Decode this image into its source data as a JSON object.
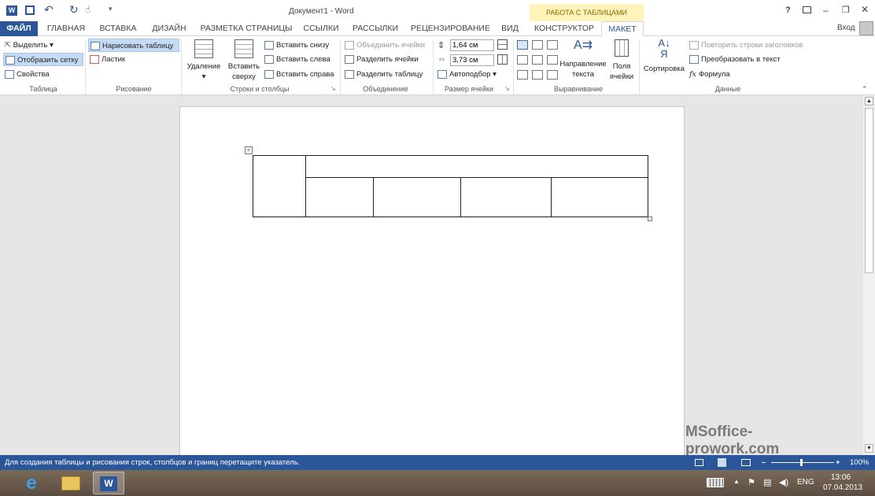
{
  "window": {
    "title": "Документ1 - Word",
    "context_group": "РАБОТА С ТАБЛИЦАМИ",
    "user": "Вход"
  },
  "tabs": [
    "ФАЙЛ",
    "ГЛАВНАЯ",
    "ВСТАВКА",
    "ДИЗАЙН",
    "РАЗМЕТКА СТРАНИЦЫ",
    "ССЫЛКИ",
    "РАССЫЛКИ",
    "РЕЦЕНЗИРОВАНИЕ",
    "ВИД",
    "КОНСТРУКТОР",
    "МАКЕТ"
  ],
  "ribbon": {
    "table_group": {
      "select": "Выделить",
      "gridlines": "Отобразить сетку",
      "properties": "Свойства",
      "label": "Таблица"
    },
    "draw_group": {
      "draw": "Нарисовать таблицу",
      "eraser": "Ластик",
      "label": "Рисование"
    },
    "rows_cols": {
      "delete": "Удаление",
      "insert_above": "Вставить сверху",
      "insert_below": "Вставить снизу",
      "insert_left": "Вставить слева",
      "insert_right": "Вставить справа",
      "label": "Строки и столбцы"
    },
    "merge": {
      "merge": "Объединить ячейки",
      "split_cells": "Разделить ячейки",
      "split_table": "Разделить таблицу",
      "label": "Объединение"
    },
    "cell_size": {
      "height": "1,64 см",
      "width": "3,73 см",
      "autofit": "Автоподбор",
      "label": "Размер ячейки"
    },
    "alignment": {
      "direction": "Направление текста",
      "margins": "Поля ячейки",
      "label": "Выравнивание"
    },
    "data": {
      "sort": "Сортировка",
      "repeat_headers": "Повторить строки заголовков",
      "convert": "Преобразовать в текст",
      "formula": "Формула",
      "label": "Данные"
    }
  },
  "status": {
    "text": "Для создания таблицы и рисования строк, столбцов и границ перетащите указатель.",
    "zoom": "100%"
  },
  "watermark": "MSoffice-prowork.com",
  "taskbar": {
    "lang": "ENG",
    "time": "13:06",
    "date": "07.04.2013"
  }
}
